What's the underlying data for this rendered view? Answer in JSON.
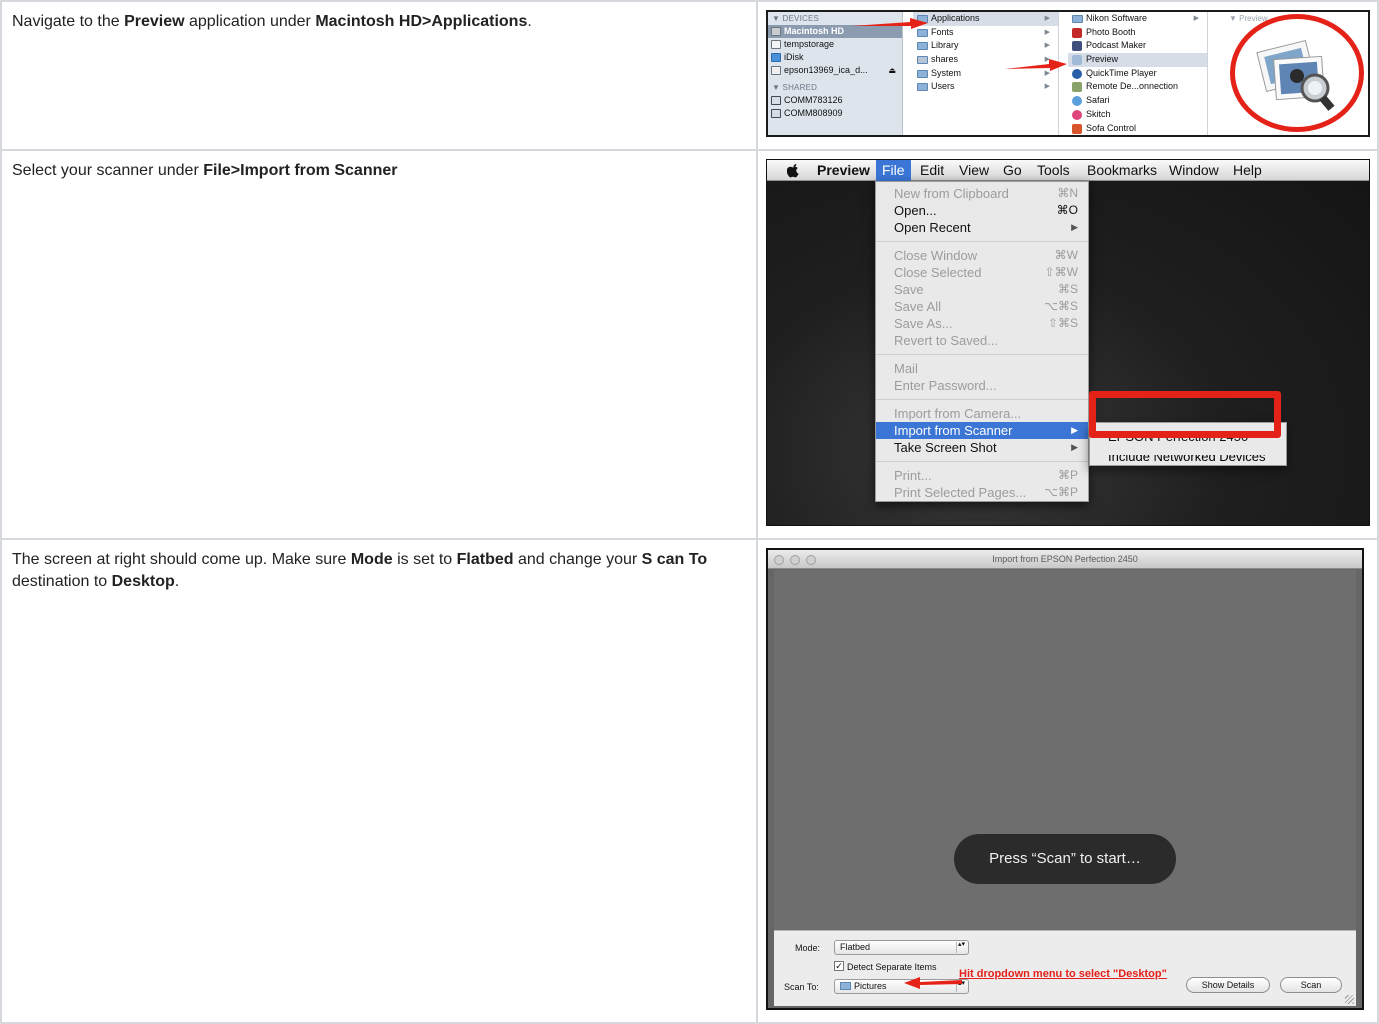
{
  "steps": [
    {
      "parts": [
        "Navigate to the ",
        "Preview",
        " application under ",
        "Macintosh HD>Applications",
        "."
      ]
    },
    {
      "parts": [
        "Select your scanner under ",
        "File>Import from Scanner"
      ]
    },
    {
      "parts": [
        "The screen at right should come up.  Make sure ",
        "Mode",
        " is set to ",
        "Flatbed",
        " and change your ",
        "S can To",
        " destination to ",
        "Desktop",
        "."
      ]
    }
  ],
  "finder": {
    "devices_header": "▼ DEVICES",
    "devices": [
      "Macintosh HD",
      "tempstorage",
      "iDisk",
      "epson13969_ica_d..."
    ],
    "eject": "⏏",
    "shared_header": "▼ SHARED",
    "shared": [
      "COMM783126",
      "COMM808909"
    ],
    "col1": [
      "Applications",
      "Fonts",
      "Library",
      "shares",
      "System",
      "Users"
    ],
    "col2": [
      "Nikon Software",
      "Photo Booth",
      "Podcast Maker",
      "Preview",
      "QuickTime Player",
      "Remote De...onnection",
      "Safari",
      "Skitch",
      "Sofa Control"
    ],
    "preview_header": "▼ Preview"
  },
  "preview_menu": {
    "apple": "",
    "menubar": [
      "Preview",
      "File",
      "Edit",
      "View",
      "Go",
      "Tools",
      "Bookmarks",
      "Window",
      "Help"
    ],
    "file_items": [
      {
        "label": "New from Clipboard",
        "shortcut": "⌘N"
      },
      {
        "label": "Open...",
        "shortcut": "⌘O"
      },
      {
        "label": "Open Recent",
        "shortcut": "▶"
      },
      {
        "label": "Close Window",
        "shortcut": "⌘W"
      },
      {
        "label": "Close Selected",
        "shortcut": "⇧⌘W"
      },
      {
        "label": "Save",
        "shortcut": "⌘S"
      },
      {
        "label": "Save All",
        "shortcut": "⌥⌘S"
      },
      {
        "label": "Save As...",
        "shortcut": "⇧⌘S"
      },
      {
        "label": "Revert to Saved...",
        "shortcut": ""
      },
      {
        "label": "Mail",
        "shortcut": ""
      },
      {
        "label": "Enter Password...",
        "shortcut": ""
      },
      {
        "label": "Import from Camera...",
        "shortcut": ""
      },
      {
        "label": "Import from Scanner",
        "shortcut": "▶"
      },
      {
        "label": "Take Screen Shot",
        "shortcut": "▶"
      },
      {
        "label": "Print...",
        "shortcut": "⌘P"
      },
      {
        "label": "Print Selected Pages...",
        "shortcut": "⌥⌘P"
      }
    ],
    "submenu": [
      "EPSON Perfection 2450",
      "Include Networked Devices"
    ]
  },
  "scanner": {
    "title": "Import from EPSON Perfection 2450",
    "prompt": "Press “Scan” to start…",
    "mode_label": "Mode:",
    "mode_value": "Flatbed",
    "detect_label": "Detect Separate Items",
    "detect_checked": "✓",
    "scan_to_label": "Scan To:",
    "scan_to_value": "Pictures",
    "stepper": "▴▾",
    "annotation": "Hit dropdown menu to select \"Desktop\"",
    "show_details": "Show Details",
    "scan_button": "Scan"
  },
  "colors": {
    "annotation_red": "#e52218",
    "menu_highlight": "#3b76d6"
  }
}
